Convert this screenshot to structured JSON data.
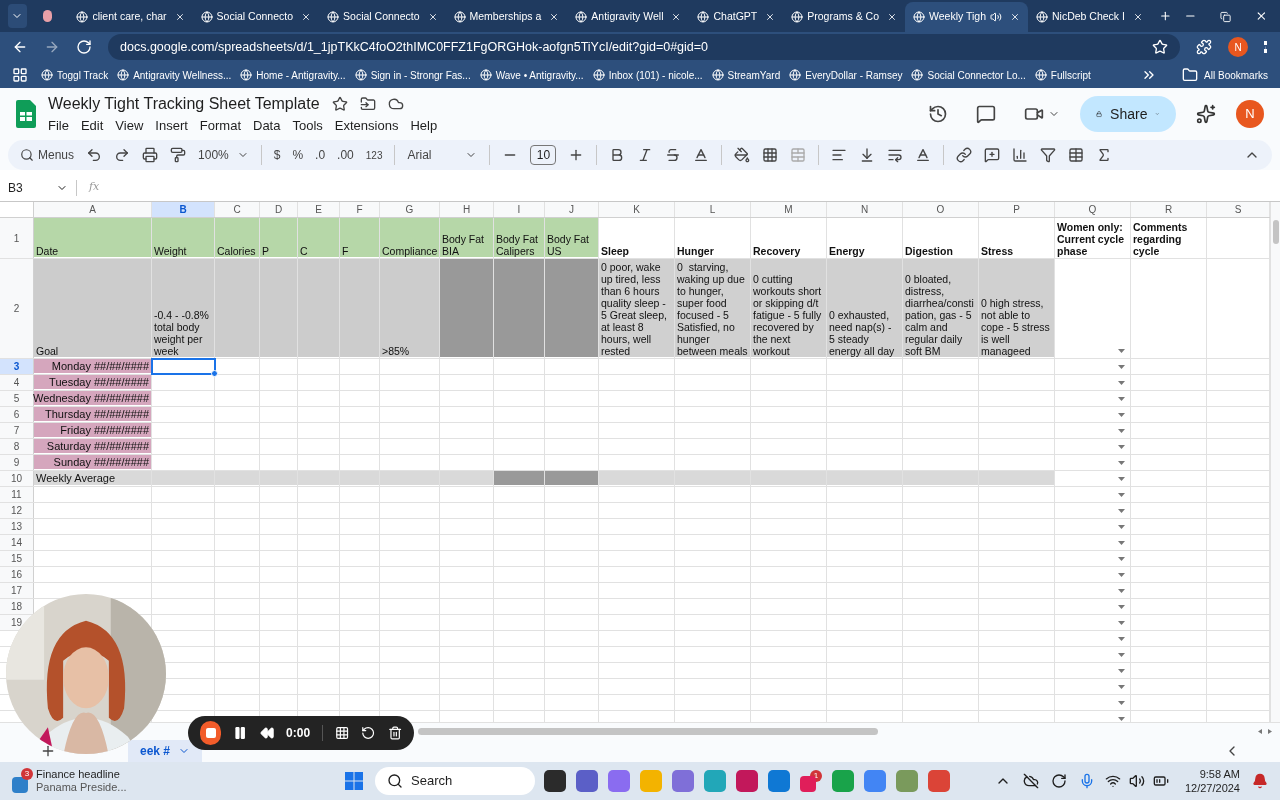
{
  "browser": {
    "tabs": [
      {
        "title": "client care, char",
        "selected": false
      },
      {
        "title": "Social Connecto",
        "selected": false
      },
      {
        "title": "Social Connecto",
        "selected": false
      },
      {
        "title": "Memberships a",
        "selected": false
      },
      {
        "title": "Antigravity Well",
        "selected": false
      },
      {
        "title": "ChatGPT",
        "selected": false
      },
      {
        "title": "Programs & Co",
        "selected": false
      },
      {
        "title": "Weekly Tigh",
        "selected": true
      },
      {
        "title": "NicDeb Check I",
        "selected": false
      }
    ],
    "url": "docs.google.com/spreadsheets/d/1_1jpTKkC4foO2thIMC0FFZ1FgORGHok-aofgn5TiYcI/edit?gid=0#gid=0",
    "profile": "N",
    "bookmarks": [
      "Toggl Track",
      "Antigravity Wellness...",
      "Home - Antigravity...",
      "Sign in - Strongr Fas...",
      "Wave • Antigravity...",
      "Inbox (101) - nicole...",
      "StreamYard",
      "EveryDollar - Ramsey",
      "Social Connector Lo...",
      "Fullscript"
    ],
    "all_bookmarks": "All Bookmarks"
  },
  "doc": {
    "title": "Weekly Tight Tracking Sheet Template",
    "menu": [
      "File",
      "Edit",
      "View",
      "Insert",
      "Format",
      "Data",
      "Tools",
      "Extensions",
      "Help"
    ],
    "share": "Share",
    "avatar": "N"
  },
  "toolbar": {
    "search": "Menus",
    "zoom": "100%",
    "currency": "$",
    "percent": "%",
    "decrease_decimals": ".0",
    "increase_decimals": ".00",
    "number_format": "123",
    "font": "Arial",
    "font_size": "10"
  },
  "formula_bar": {
    "name_box": "B3",
    "fx": "fx"
  },
  "sheet": {
    "columns": [
      {
        "label": "A",
        "selected": false
      },
      {
        "label": "B",
        "selected": true
      },
      {
        "label": "C",
        "selected": false
      },
      {
        "label": "D",
        "selected": false
      },
      {
        "label": "E",
        "selected": false
      },
      {
        "label": "F",
        "selected": false
      },
      {
        "label": "G",
        "selected": false
      },
      {
        "label": "H",
        "selected": false
      },
      {
        "label": "I",
        "selected": false
      },
      {
        "label": "J",
        "selected": false
      },
      {
        "label": "K",
        "selected": false
      },
      {
        "label": "L",
        "selected": false
      },
      {
        "label": "M",
        "selected": false
      },
      {
        "label": "N",
        "selected": false
      },
      {
        "label": "O",
        "selected": false
      },
      {
        "label": "P",
        "selected": false
      },
      {
        "label": "Q",
        "selected": false
      },
      {
        "label": "R",
        "selected": false
      },
      {
        "label": "S",
        "selected": false
      }
    ],
    "rows": [
      {
        "number": "1",
        "selected": false,
        "cells": [
          {
            "text": "Date",
            "color": "#b6d7a8"
          },
          {
            "text": "Weight",
            "color": "#b6d7a8"
          },
          {
            "text": "Calories",
            "color": "#b6d7a8"
          },
          {
            "text": "P",
            "color": "#b6d7a8"
          },
          {
            "text": "C",
            "color": "#b6d7a8"
          },
          {
            "text": "F",
            "color": "#b6d7a8"
          },
          {
            "text": "Compliance",
            "color": "#b6d7a8"
          },
          {
            "text": "Body Fat BIA",
            "color": "#b6d7a8"
          },
          {
            "text": "Body Fat Calipers",
            "color": "#b6d7a8"
          },
          {
            "text": "Body Fat US",
            "color": "#b6d7a8"
          },
          {
            "text": "Sleep",
            "bold": true
          },
          {
            "text": "Hunger",
            "bold": true
          },
          {
            "text": "Recovery",
            "bold": true
          },
          {
            "text": "Energy",
            "bold": true
          },
          {
            "text": "Digestion",
            "bold": true
          },
          {
            "text": "Stress",
            "bold": true
          },
          {
            "text": "Women only: Current cycle phase",
            "bold": true
          },
          {
            "text": "Comments regarding cycle",
            "bold": true
          }
        ]
      },
      {
        "number": "2",
        "selected": false,
        "cells": [
          {
            "text": "Goal",
            "color": "#cccccc"
          },
          {
            "text": "-0.4 - -0.8% total body weight per week",
            "color": "#cccccc"
          },
          {
            "color": "#cccccc"
          },
          {
            "color": "#cccccc"
          },
          {
            "color": "#cccccc"
          },
          {
            "color": "#cccccc"
          },
          {
            "text": ">85%",
            "color": "#cccccc"
          },
          {
            "color": "#999999"
          },
          {
            "color": "#999999"
          },
          {
            "color": "#999999"
          },
          {
            "text": "0 poor, wake up tired, less than 6 hours quality sleep - 5 Great sleep, at least 8 hours, well rested",
            "color": "#d0d0d0"
          },
          {
            "text": "0  starving, waking up due to hunger, super food focused - 5 Satisfied, no hunger between meals",
            "color": "#d0d0d0"
          },
          {
            "text": "0 cutting workouts short or skipping d/t fatigue - 5 fully recovered by the next workout",
            "color": "#d0d0d0"
          },
          {
            "text": "0 exhausted, need nap(s) - 5 steady energy all day",
            "color": "#d0d0d0"
          },
          {
            "text": "0 bloated, distress, diarrhea/constipation, gas - 5 calm and regular daily soft BM",
            "color": "#d0d0d0"
          },
          {
            "text": "0 high stress, not able to cope - 5 stress is well manageed",
            "color": "#d0d0d0"
          }
        ]
      },
      {
        "number": "3",
        "selected": true,
        "cells": [
          {
            "text": "Monday ##/##/####",
            "kind": "day",
            "color": "#d5a6bd"
          }
        ]
      },
      {
        "number": "4",
        "selected": false,
        "cells": [
          {
            "text": "Tuesday ##/##/####",
            "kind": "day",
            "color": "#d5a6bd"
          }
        ]
      },
      {
        "number": "5",
        "selected": false,
        "cells": [
          {
            "text": "Wednesday ##/##/####",
            "kind": "day",
            "color": "#d5a6bd"
          }
        ]
      },
      {
        "number": "6",
        "selected": false,
        "cells": [
          {
            "text": "Thursday ##/##/####",
            "kind": "day",
            "color": "#d5a6bd"
          }
        ]
      },
      {
        "number": "7",
        "selected": false,
        "cells": [
          {
            "text": "Friday ##/##/####",
            "kind": "day",
            "color": "#d5a6bd"
          }
        ]
      },
      {
        "number": "8",
        "selected": false,
        "cells": [
          {
            "text": "Saturday ##/##/####",
            "kind": "day",
            "color": "#d5a6bd"
          }
        ]
      },
      {
        "number": "9",
        "selected": false,
        "cells": [
          {
            "text": "Sunday ##/##/####",
            "kind": "day",
            "color": "#d5a6bd"
          }
        ]
      },
      {
        "number": "10",
        "selected": false,
        "cells": [
          {
            "text": "Weekly Average",
            "color": "#d9d9d9"
          },
          {
            "color": "#d9d9d9"
          },
          {
            "color": "#d9d9d9"
          },
          {
            "color": "#d9d9d9"
          },
          {
            "color": "#d9d9d9"
          },
          {
            "color": "#d9d9d9"
          },
          {
            "color": "#d9d9d9"
          },
          {
            "color": "#d9d9d9"
          },
          {
            "color": "#999999"
          },
          {
            "color": "#999999"
          },
          {
            "color": "#d9d9d9"
          },
          {
            "color": "#d9d9d9"
          },
          {
            "color": "#d9d9d9"
          },
          {
            "color": "#d9d9d9"
          },
          {
            "color": "#d9d9d9"
          },
          {
            "color": "#d9d9d9"
          }
        ]
      },
      {
        "number": "11",
        "selected": false,
        "cells": []
      },
      {
        "number": "12",
        "selected": false,
        "cells": []
      },
      {
        "number": "13",
        "selected": false,
        "cells": []
      },
      {
        "number": "14",
        "selected": false,
        "cells": []
      },
      {
        "number": "15",
        "selected": false,
        "cells": []
      },
      {
        "number": "16",
        "selected": false,
        "cells": []
      },
      {
        "number": "17",
        "selected": false,
        "cells": []
      },
      {
        "number": "18",
        "selected": false,
        "cells": []
      },
      {
        "number": "19",
        "selected": false,
        "cells": []
      }
    ],
    "tab": "eek #"
  },
  "recorder": {
    "time": "0:00"
  },
  "taskbar": {
    "news_badge": "3",
    "news_title": "Finance headline",
    "news_text": "Panama Preside...",
    "search": "Search",
    "app_badge": "1",
    "time": "9:58 AM",
    "date": "12/27/2024"
  }
}
